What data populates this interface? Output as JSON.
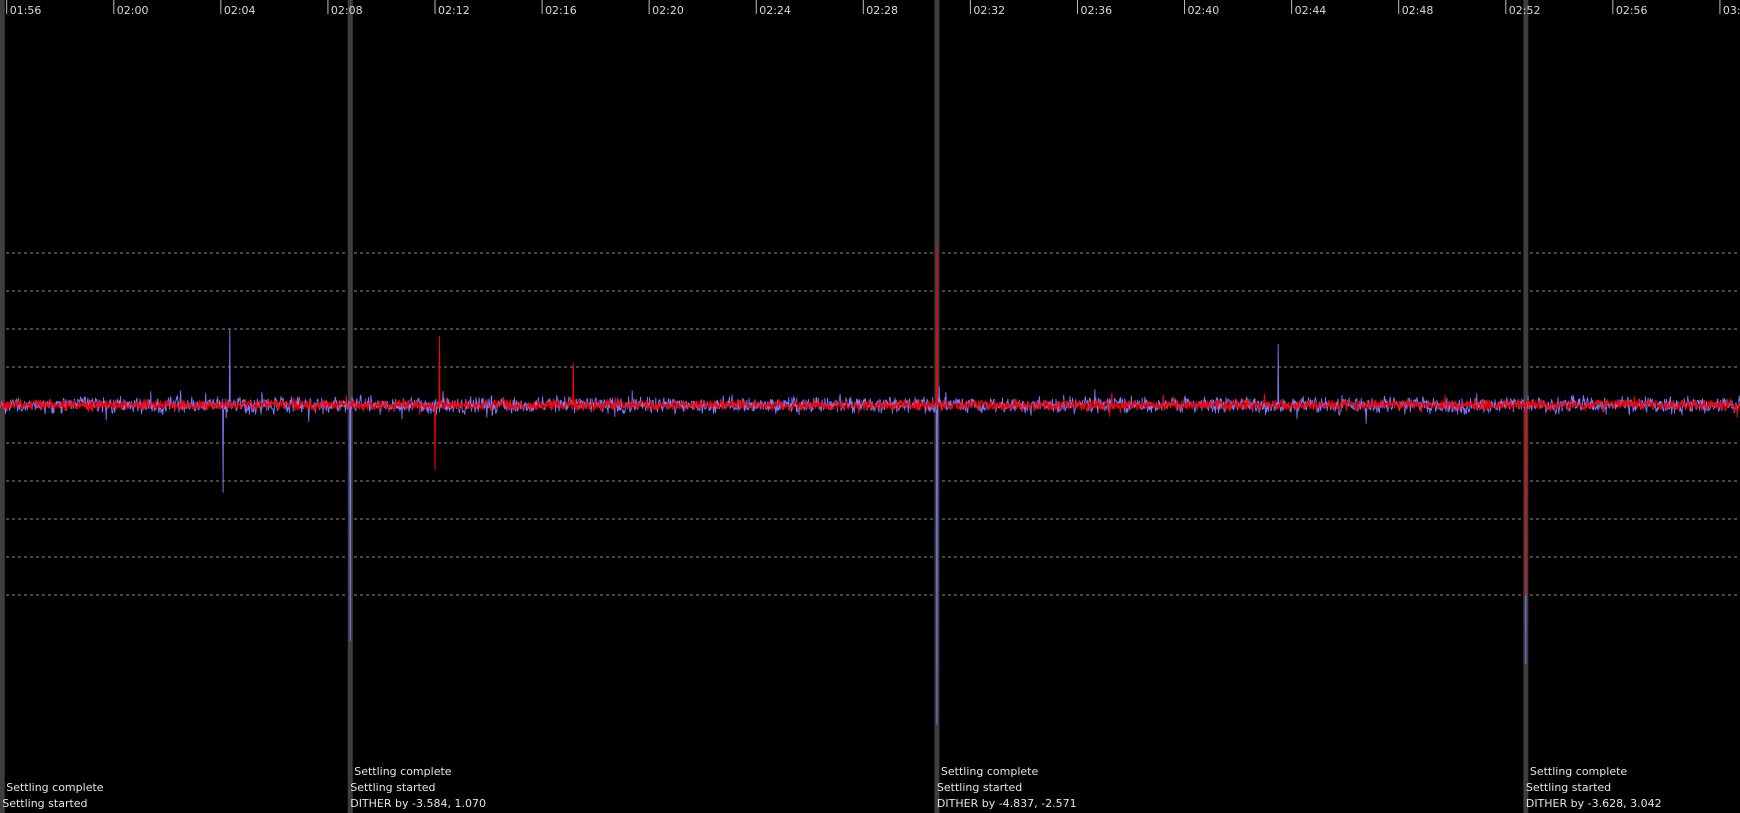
{
  "chart_data": {
    "type": "line",
    "title": "",
    "xlabel": "",
    "ylabel": "",
    "x_tick_labels": [
      "01:56",
      "02:00",
      "02:04",
      "02:08",
      "02:12",
      "02:16",
      "02:20",
      "02:24",
      "02:28",
      "02:32",
      "02:36",
      "02:40",
      "02:44",
      "02:48",
      "02:52",
      "02:56",
      "03:00"
    ],
    "x_range": [
      "01:55:45",
      "03:00:45"
    ],
    "grid": "horizontal dashed",
    "series": [
      {
        "color": "#7b7bff",
        "values_approx": {
          "baseline": 0.0,
          "typical_amplitude": 0.55,
          "max_excursions": [
            {
              "t": "02:04:20",
              "v": 2.0
            },
            {
              "t": "02:04:05",
              "v": -2.3
            },
            {
              "t": "02:08:50",
              "v": -6.2
            },
            {
              "t": "02:30:45",
              "v": 1.1
            },
            {
              "t": "02:30:45",
              "v": -8.4
            },
            {
              "t": "02:52:45",
              "v": 1.5
            },
            {
              "t": "02:52:45",
              "v": -6.8
            },
            {
              "t": "02:43:30",
              "v": 1.6
            }
          ]
        }
      },
      {
        "color": "#ff0000",
        "values_approx": {
          "baseline": 0.0,
          "typical_amplitude": 0.35,
          "max_excursions": [
            {
              "t": "02:12:10",
              "v": 1.8
            },
            {
              "t": "02:12:00",
              "v": -1.7
            },
            {
              "t": "02:30:45",
              "v": 4.2
            },
            {
              "t": "02:52:45",
              "v": -5.0
            },
            {
              "t": "02:17:10",
              "v": 1.1
            }
          ]
        }
      }
    ],
    "events": [
      {
        "time": "01:55:50",
        "lines": [
          "Settling complete",
          "Settling started"
        ]
      },
      {
        "time": "02:08:50",
        "lines": [
          "Settling complete",
          "Settling started",
          "DITHER by -3.584, 1.070"
        ]
      },
      {
        "time": "02:30:45",
        "lines": [
          "Settling complete",
          "Settling started",
          "DITHER by -4.837, -2.571"
        ]
      },
      {
        "time": "02:52:45",
        "lines": [
          "Settling complete",
          "Settling started",
          "DITHER by -3.628, 3.042"
        ]
      }
    ]
  }
}
